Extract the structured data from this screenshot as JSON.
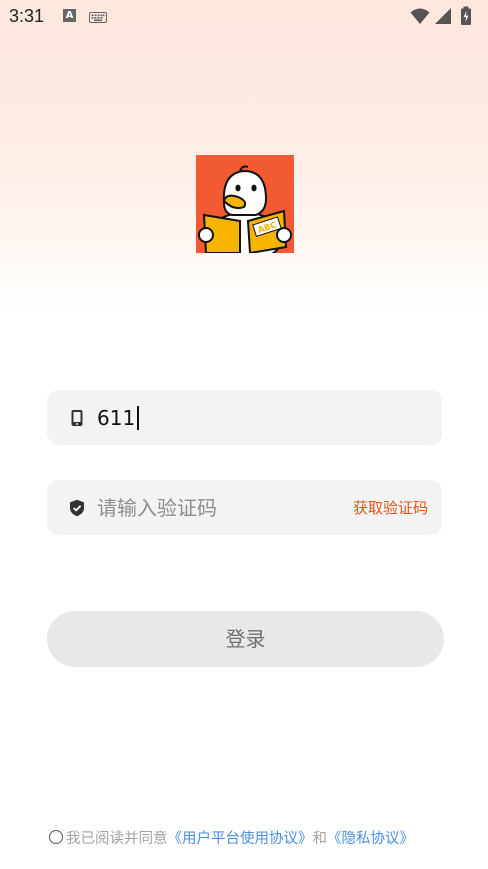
{
  "status_bar": {
    "time": "3:31",
    "icons": [
      "a-notification-icon",
      "keyboard-icon",
      "wifi-icon",
      "signal-icon",
      "battery-icon"
    ]
  },
  "logo": {
    "alt": "duck-reading-book-logo",
    "book_text": "ABC",
    "colors": {
      "background": "#f15a32",
      "book": "#f5b400"
    }
  },
  "login_form": {
    "phone": {
      "icon": "phone-icon",
      "value": "611"
    },
    "code": {
      "icon": "shield-check-icon",
      "placeholder": "请输入验证码",
      "get_code_label": "获取验证码"
    },
    "login_button_label": "登录"
  },
  "agreement": {
    "prefix": "我已阅读并同意",
    "user_agreement_link": "《用户平台使用协议》",
    "conjunction": "和",
    "privacy_link": "《隐私协议》"
  },
  "colors": {
    "accent": "#e0541a",
    "link": "#4a90e2",
    "field_bg": "#f3f3f3",
    "button_bg": "#e8e8e8"
  }
}
